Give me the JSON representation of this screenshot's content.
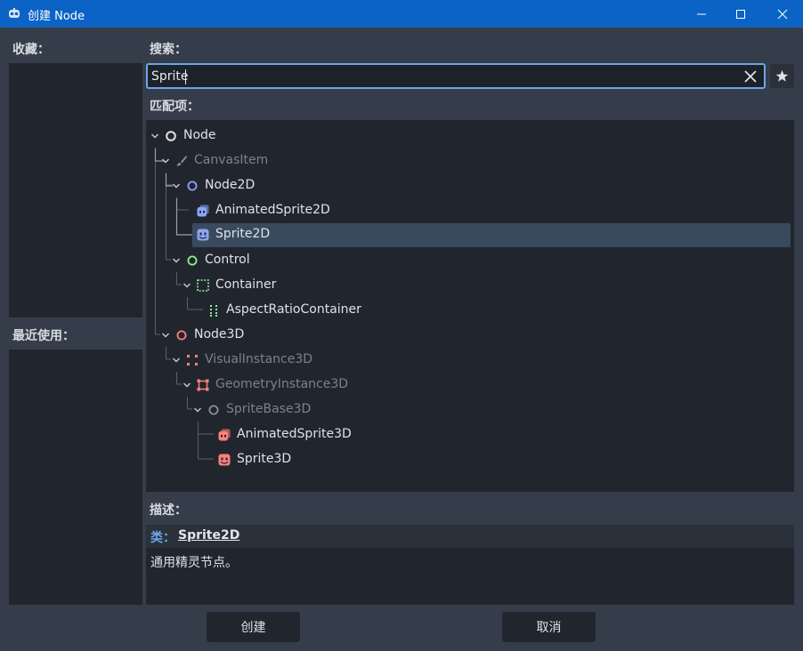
{
  "window": {
    "title": "创建 Node",
    "controls": [
      "minimize-icon",
      "maximize-icon",
      "close-icon"
    ]
  },
  "left": {
    "favorites_label": "收藏：",
    "recent_label": "最近使用："
  },
  "search": {
    "label": "搜索：",
    "value": "Sprite",
    "favorite_icon": "star-icon",
    "clear_icon": "close-icon"
  },
  "matches": {
    "label": "匹配项：",
    "items": [
      {
        "label": "Node",
        "icon": "node-icon",
        "color": "#e0e0e0",
        "dimmed": false,
        "expanded": true
      },
      {
        "label": "CanvasItem",
        "icon": "canvasitem-icon",
        "color": "#8a8f96",
        "dimmed": true,
        "expanded": true
      },
      {
        "label": "Node2D",
        "icon": "node2d-icon",
        "color": "#8da5f3",
        "dimmed": false,
        "expanded": true
      },
      {
        "label": "AnimatedSprite2D",
        "icon": "animated-sprite-2d-icon",
        "color": "#8da5f3",
        "dimmed": false
      },
      {
        "label": "Sprite2D",
        "icon": "sprite-2d-icon",
        "color": "#8da5f3",
        "dimmed": false,
        "selected": true
      },
      {
        "label": "Control",
        "icon": "control-icon",
        "color": "#8eef97",
        "dimmed": false,
        "expanded": true
      },
      {
        "label": "Container",
        "icon": "container-icon",
        "color": "#8eef97",
        "dimmed": false,
        "expanded": true
      },
      {
        "label": "AspectRatioContainer",
        "icon": "aspect-ratio-container-icon",
        "color": "#8eef97",
        "dimmed": false
      },
      {
        "label": "Node3D",
        "icon": "node3d-icon",
        "color": "#fc7f7f",
        "dimmed": false,
        "expanded": true
      },
      {
        "label": "VisualInstance3D",
        "icon": "visual-instance-3d-icon",
        "color": "#fc7f7f",
        "dimmed": true,
        "expanded": true
      },
      {
        "label": "GeometryInstance3D",
        "icon": "geometry-instance-3d-icon",
        "color": "#fc7f7f",
        "dimmed": true,
        "expanded": true
      },
      {
        "label": "SpriteBase3D",
        "icon": "sprite-base-3d-icon",
        "color": "#8a8f96",
        "dimmed": true,
        "expanded": true
      },
      {
        "label": "AnimatedSprite3D",
        "icon": "animated-sprite-3d-icon",
        "color": "#fc7f7f",
        "dimmed": false
      },
      {
        "label": "Sprite3D",
        "icon": "sprite-3d-icon",
        "color": "#fc7f7f",
        "dimmed": false
      }
    ]
  },
  "description": {
    "label": "描述：",
    "class_key": "类：",
    "class_name": "Sprite2D",
    "text": "通用精灵节点。"
  },
  "buttons": {
    "create": "创建",
    "cancel": "取消"
  },
  "colors": {
    "accent": "#6aa6ea",
    "titlebar": "#0a63c5",
    "selection": "#3a4a5e"
  }
}
